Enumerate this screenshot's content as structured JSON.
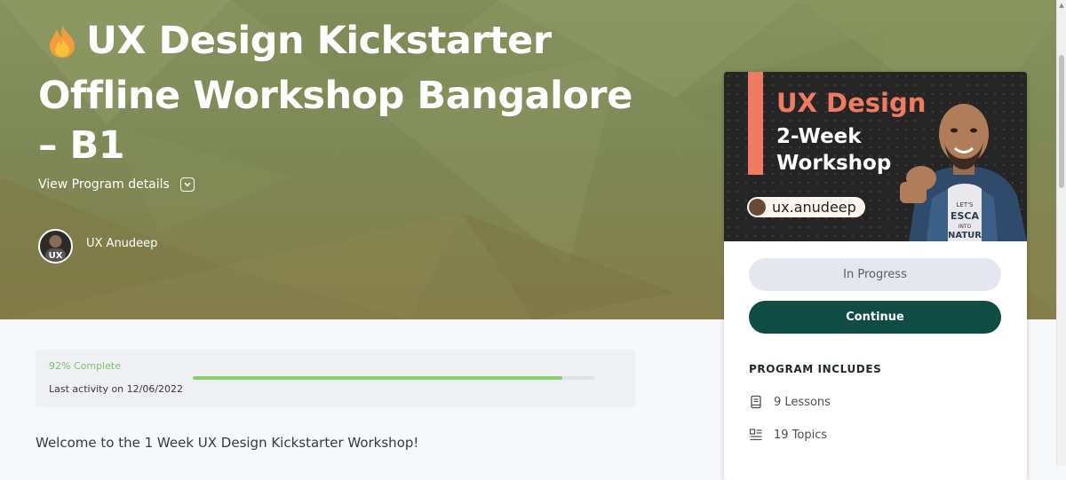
{
  "hero": {
    "title": "UX Design Kickstarter Offline Workshop Bangalore – B1",
    "details_label": "View Program details",
    "author_name": "UX Anudeep",
    "author_avatar_text": "UX"
  },
  "progress": {
    "percent_label": "92% Complete",
    "percent": 92,
    "last_activity": "Last activity on 12/06/2022"
  },
  "welcome_text": "Welcome to the 1 Week UX Design Kickstarter Workshop!",
  "sidebar": {
    "thumbnail": {
      "line1": "UX Design",
      "line2": "2-Week",
      "line3": "Workshop",
      "handle": "ux.anudeep",
      "shirt_text": "LET'S ESCAPE INTO NATURE"
    },
    "status_label": "In Progress",
    "continue_label": "Continue",
    "includes_title": "PROGRAM INCLUDES",
    "includes": [
      {
        "icon": "book-icon",
        "label": "9 Lessons"
      },
      {
        "icon": "list-icon",
        "label": "19 Topics"
      }
    ]
  },
  "colors": {
    "hero_olive": "#7d8956",
    "accent_green": "#0e4c44",
    "progress_green": "#86cf73",
    "thumb_accent": "#ee7b62"
  }
}
